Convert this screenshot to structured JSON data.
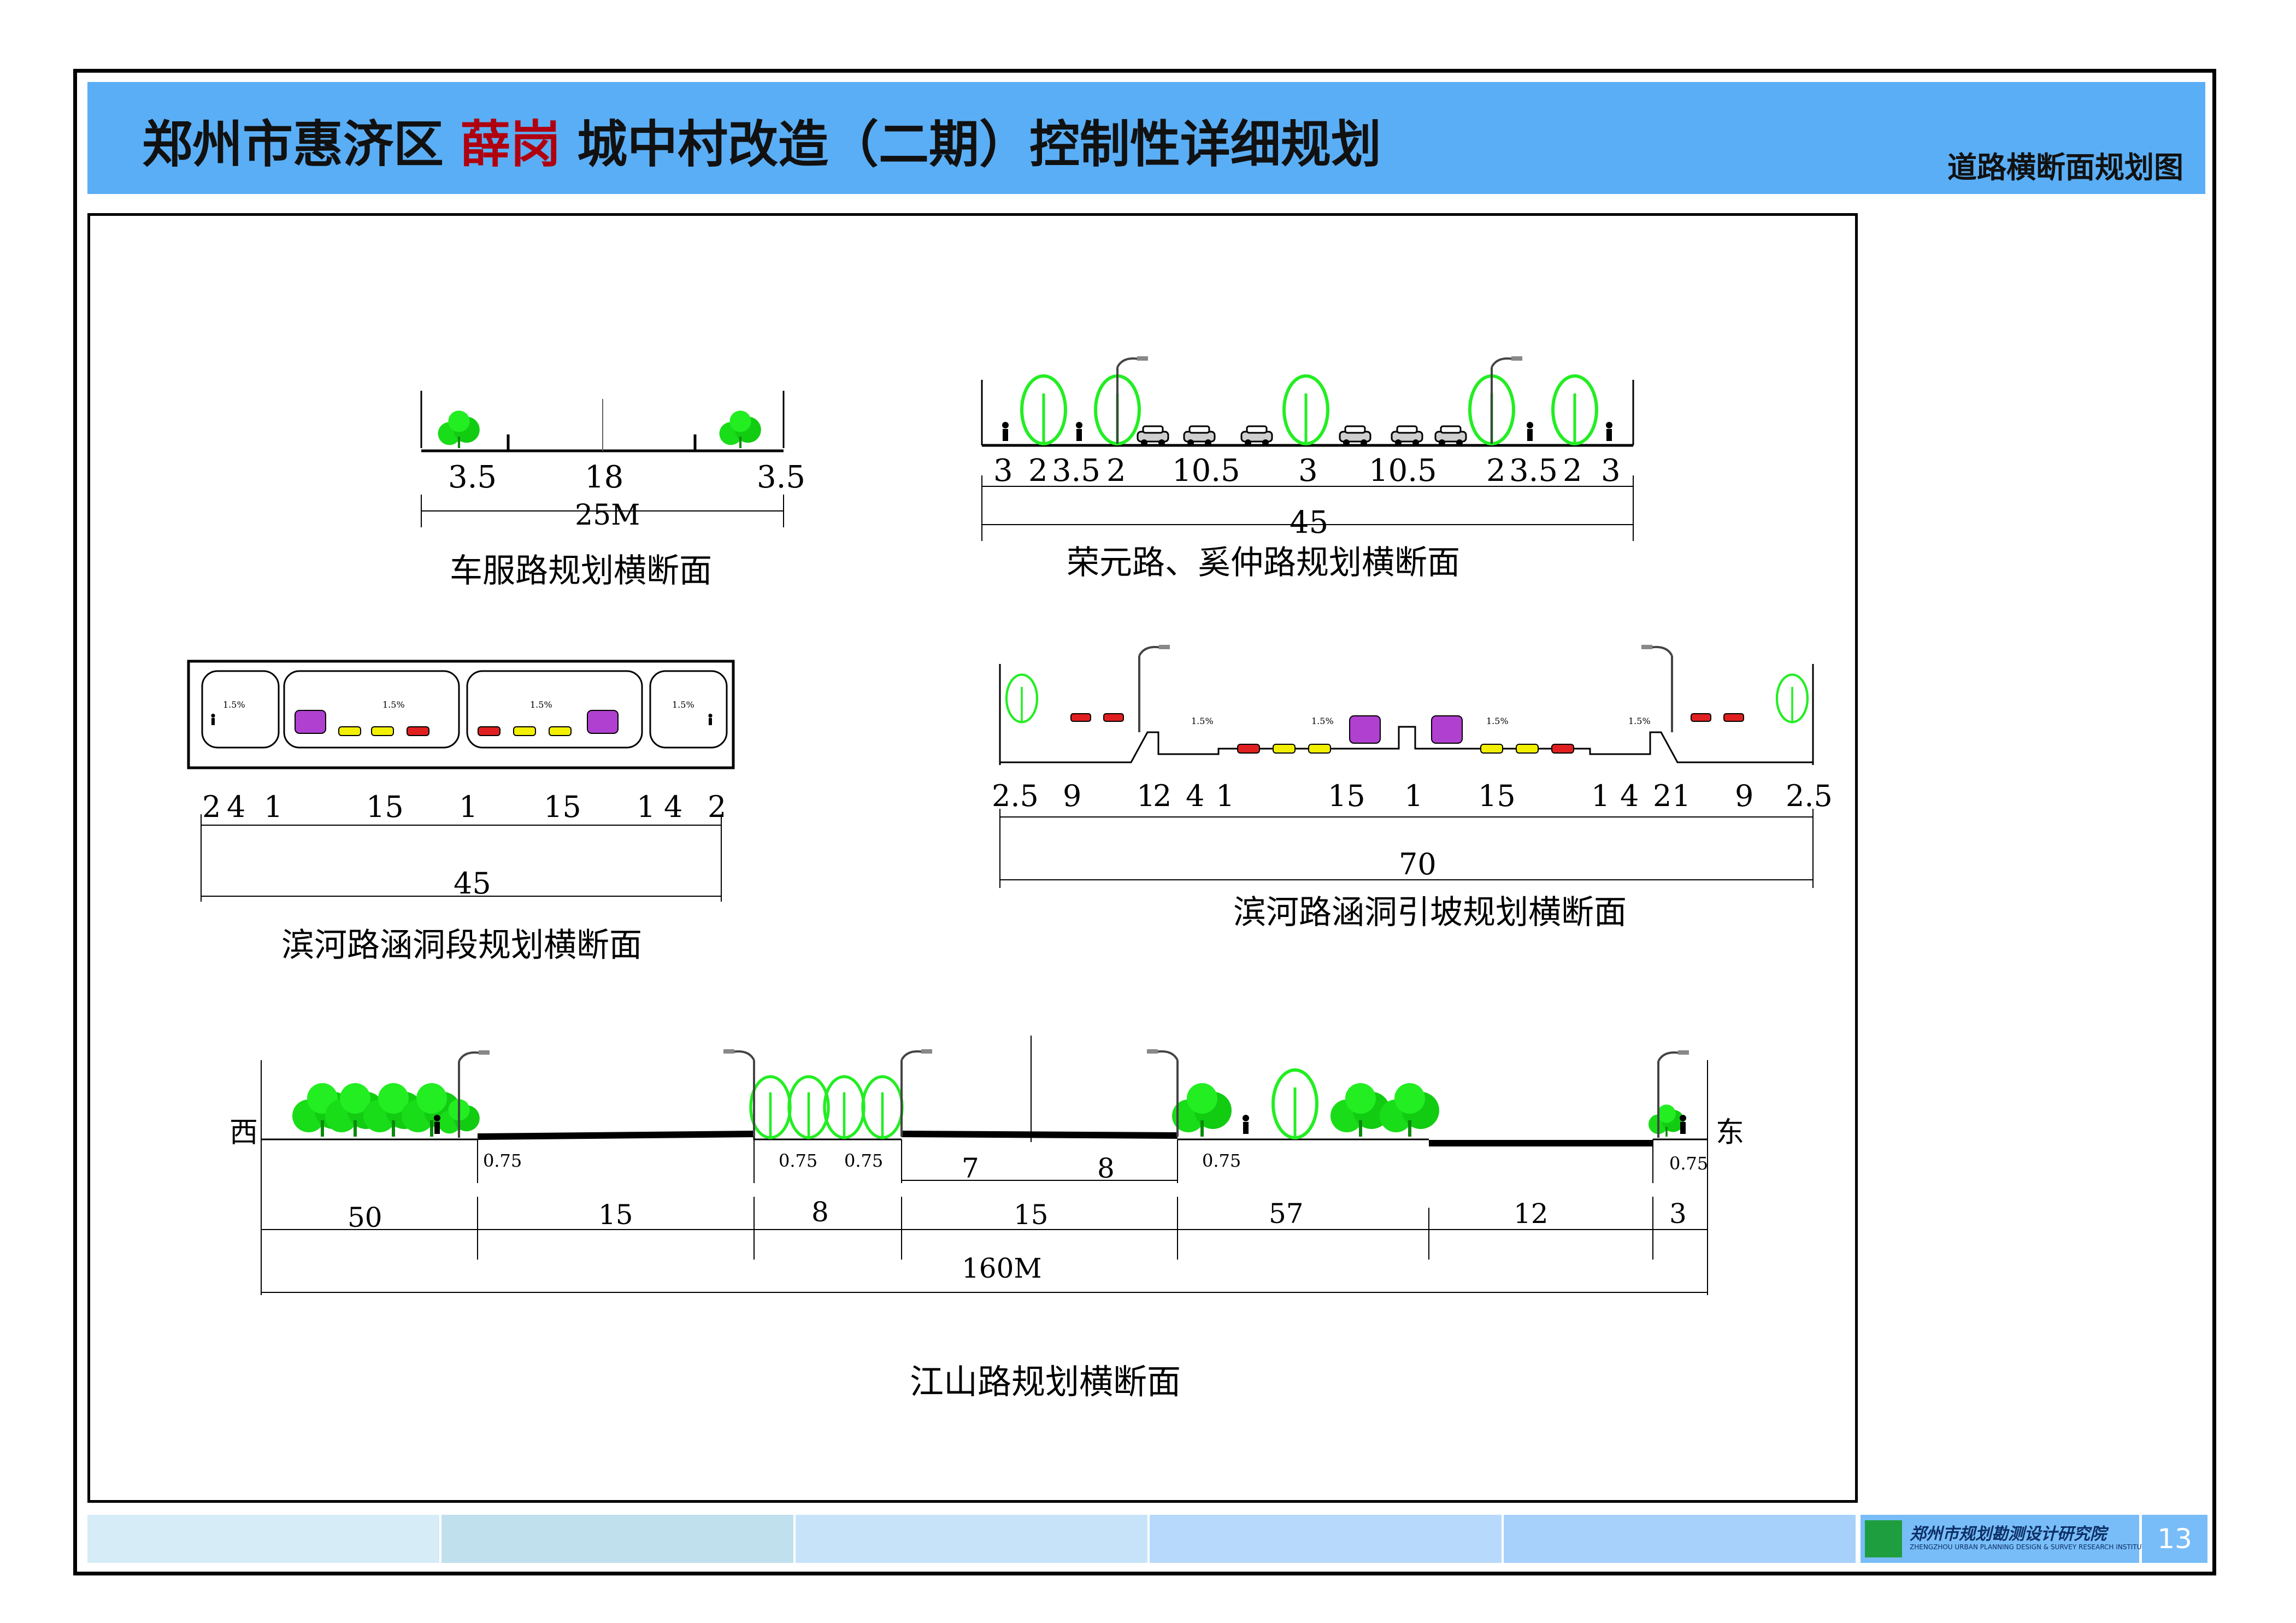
{
  "header": {
    "title_prefix": "郑州市惠济区",
    "title_highlight": "薛岗",
    "title_suffix": "城中村改造（二期）控制性详细规划",
    "subtitle": "道路横断面规划图"
  },
  "sections": {
    "chefu": {
      "caption": "车服路规划横断面",
      "widths": [
        "3.5",
        "18",
        "3.5"
      ],
      "total": "25M"
    },
    "rongyuan": {
      "caption": "荣元路、奚仲路规划横断面",
      "widths": [
        "3",
        "2",
        "3.5",
        "2",
        "10.5",
        "3",
        "10.5",
        "2",
        "3.5",
        "2",
        "3"
      ],
      "total": "45"
    },
    "binhe_culvert": {
      "caption": "滨河路涵洞段规划横断面",
      "widths": [
        "2",
        "4",
        "1",
        "15",
        "1",
        "15",
        "1",
        "4",
        "2"
      ],
      "total": "45",
      "slope_label": "1.5%"
    },
    "binhe_ramp": {
      "caption": "滨河路涵洞引坡规划横断面",
      "widths": [
        "2.5",
        "9",
        "1",
        "2",
        "4",
        "1",
        "15",
        "1",
        "15",
        "1",
        "4",
        "2",
        "1",
        "9",
        "2.5"
      ],
      "total": "70",
      "slope_label": "1.5%"
    },
    "jiangshan": {
      "caption": "江山路规划横断面",
      "west": "西",
      "east": "东",
      "small": [
        "0.75",
        "0.75",
        "0.75",
        "0.75",
        "0.75"
      ],
      "sub": [
        "7",
        "8"
      ],
      "widths": [
        "50",
        "15",
        "8",
        "15",
        "57",
        "12",
        "3"
      ],
      "total": "160M"
    }
  },
  "footer": {
    "org_cn": "郑州市规划勘测设计研究院",
    "org_en": "ZHENGZHOU URBAN PLANNING DESIGN & SURVEY RESEARCH INSTITUTE",
    "page": "13"
  },
  "colors": {
    "title_bar": "#5aaef5",
    "highlight": "#b00010",
    "tree": "#22ee22",
    "road": "#000000",
    "bus": "#b040d0",
    "car_yellow": "#f2f000",
    "car_red": "#e02020"
  }
}
